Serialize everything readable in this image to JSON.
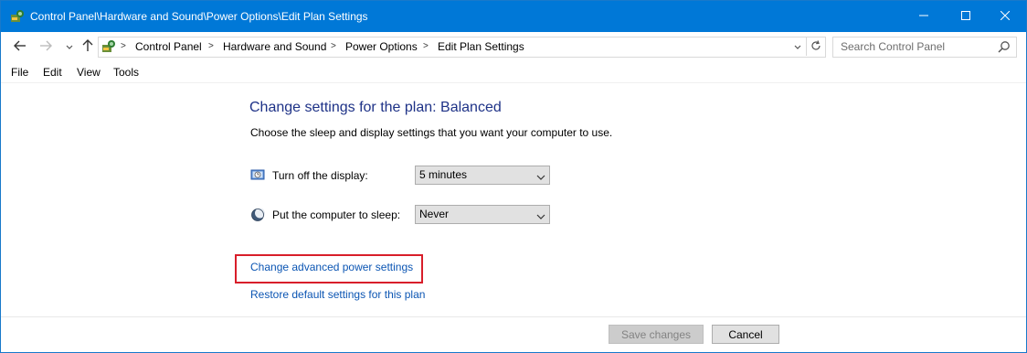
{
  "window": {
    "title": "Control Panel\\Hardware and Sound\\Power Options\\Edit Plan Settings",
    "controls": {
      "minimize": "minimize-icon",
      "maximize": "maximize-icon",
      "close": "close-icon"
    }
  },
  "nav": {
    "breadcrumbs": [
      "Control Panel",
      "Hardware and Sound",
      "Power Options",
      "Edit Plan Settings"
    ],
    "separator": ">",
    "search_placeholder": "Search Control Panel"
  },
  "menu": {
    "items": [
      "File",
      "Edit",
      "View",
      "Tools"
    ]
  },
  "content": {
    "heading": "Change settings for the plan: Balanced",
    "description": "Choose the sleep and display settings that you want your computer to use.",
    "settings": [
      {
        "label": "Turn off the display:",
        "value": "5 minutes",
        "icon": "monitor-clock-icon"
      },
      {
        "label": "Put the computer to sleep:",
        "value": "Never",
        "icon": "moon-icon"
      }
    ],
    "links": {
      "advanced": "Change advanced power settings",
      "restore": "Restore default settings for this plan"
    }
  },
  "footer": {
    "save_label": "Save changes",
    "cancel_label": "Cancel"
  },
  "colors": {
    "titlebar": "#0078d7",
    "heading": "#1e3287",
    "link": "#0b55b3",
    "highlight": "#d81e2a"
  }
}
